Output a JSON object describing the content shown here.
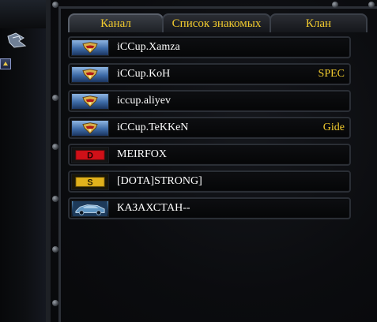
{
  "tabs": [
    {
      "label": "Канал",
      "active": true
    },
    {
      "label": "Список знакомых",
      "active": false
    },
    {
      "label": "Клан",
      "active": false
    }
  ],
  "channel_users": [
    {
      "name": "iCCup.Xamza",
      "tag": "",
      "icon": "gold-emblem-badge-icon"
    },
    {
      "name": "iCCup.KoH",
      "tag": "SPEC",
      "icon": "gold-emblem-badge-icon"
    },
    {
      "name": "iccup.aliyev",
      "tag": "",
      "icon": "gold-emblem-badge-icon"
    },
    {
      "name": "iCCup.TeKKeN",
      "tag": "Gide",
      "icon": "gold-emblem-badge-icon"
    },
    {
      "name": "MEIRFOX",
      "tag": "",
      "icon": "rank-d-icon"
    },
    {
      "name": "[DOTA]STRONG]",
      "tag": "",
      "icon": "rank-s-icon"
    },
    {
      "name": "КАЗАХСТАН--",
      "tag": "",
      "icon": "vehicle-portrait-icon"
    }
  ],
  "colors": {
    "tab_text": "#f3cc2e",
    "name_text": "#ffffff",
    "tag_text": "#f3cc2e",
    "rank_d": "#e0141c",
    "rank_s": "#e8b820"
  }
}
